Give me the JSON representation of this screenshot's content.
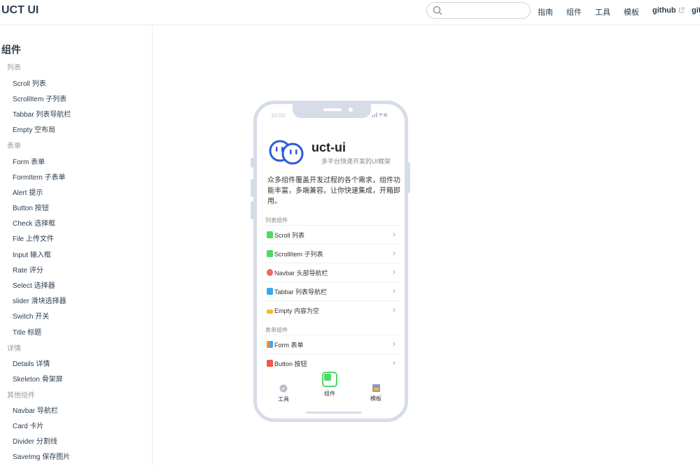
{
  "header": {
    "title": "UCT UI",
    "search": {
      "placeholder": "",
      "value": ""
    },
    "links": [
      "指南",
      "组件",
      "工具",
      "模板"
    ],
    "github_label": "github",
    "github2_label": "git"
  },
  "sidebar": {
    "heading": "组件",
    "groups": [
      {
        "label": "列表",
        "items": [
          "Scroll 列表",
          "ScrollItem 子列表",
          "Tabbar 列表导航栏",
          "Empty 空布局"
        ]
      },
      {
        "label": "表单",
        "items": [
          "Form 表单",
          "FormItem 子表单",
          "Alert 提示",
          "Button 按钮",
          "Check 选择框",
          "File 上传文件",
          "Input 输入框",
          "Rate 评分",
          "Select 选择器",
          "slider 滑块选择器",
          "Switch 开关",
          "Title 标题"
        ]
      },
      {
        "label": "详情",
        "items": [
          "Details 详情",
          "Skeleton 骨架屏"
        ]
      },
      {
        "label": "其他组件",
        "items": [
          "Navbar 导航栏",
          "Card 卡片",
          "Divider 分割线",
          "SaveImg 保存图片"
        ]
      }
    ]
  },
  "phone": {
    "status_time": "10:00",
    "app_name": "uct-ui",
    "app_subtitle": "多平台快速开发的UI框架",
    "description": "众多组件覆盖开发过程的各个需求，组件功能丰富，多端兼容。让你快速集成，开箱即用。",
    "sections": [
      {
        "label": "列表组件",
        "rows": [
          {
            "label": "Scroll 列表",
            "color": "#4cd964"
          },
          {
            "label": "ScrollItem 子列表",
            "color": "#4cd964"
          },
          {
            "label": "Navbar 头部导航栏",
            "color": "#f0685a"
          },
          {
            "label": "Tabbar 列表导航栏",
            "color": "#3aa7f0"
          },
          {
            "label": "Empty 内容为空",
            "color": "#f5b82e"
          }
        ]
      },
      {
        "label": "表单组件",
        "rows": [
          {
            "label": "Form 表单",
            "color": "#f08a3a"
          },
          {
            "label": "Button 按钮",
            "color": "#f0584a"
          }
        ]
      }
    ],
    "tabs": [
      "工具",
      "组件",
      "模板"
    ],
    "accent": "#4cd964"
  }
}
